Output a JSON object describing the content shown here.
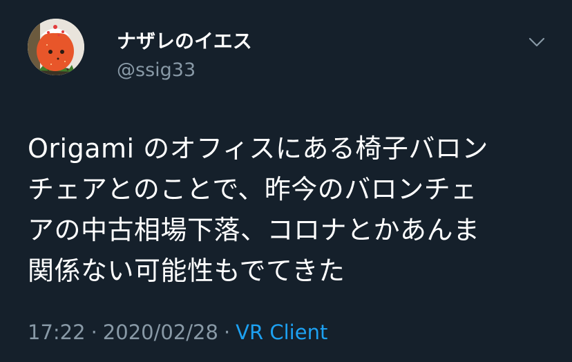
{
  "user": {
    "display_name": "ナザレのイエス",
    "handle": "@ssig33",
    "avatar_icon": "strawberry-character-avatar"
  },
  "tweet": {
    "text": "Origami のオフィスにある椅子バロン\nチェアとのことで、昨今のバロンチェ\nアの中古相場下落、コロナとかあんま\n関係ない可能性もでてきた"
  },
  "meta": {
    "time": "17:22",
    "separator": "·",
    "date": "2020/02/28",
    "client": "VR Client"
  },
  "icons": {
    "menu": "chevron-down-icon"
  },
  "colors": {
    "background": "#15202b",
    "primary_text": "#ffffff",
    "secondary_text": "#8899a6",
    "accent": "#1da1f2"
  }
}
